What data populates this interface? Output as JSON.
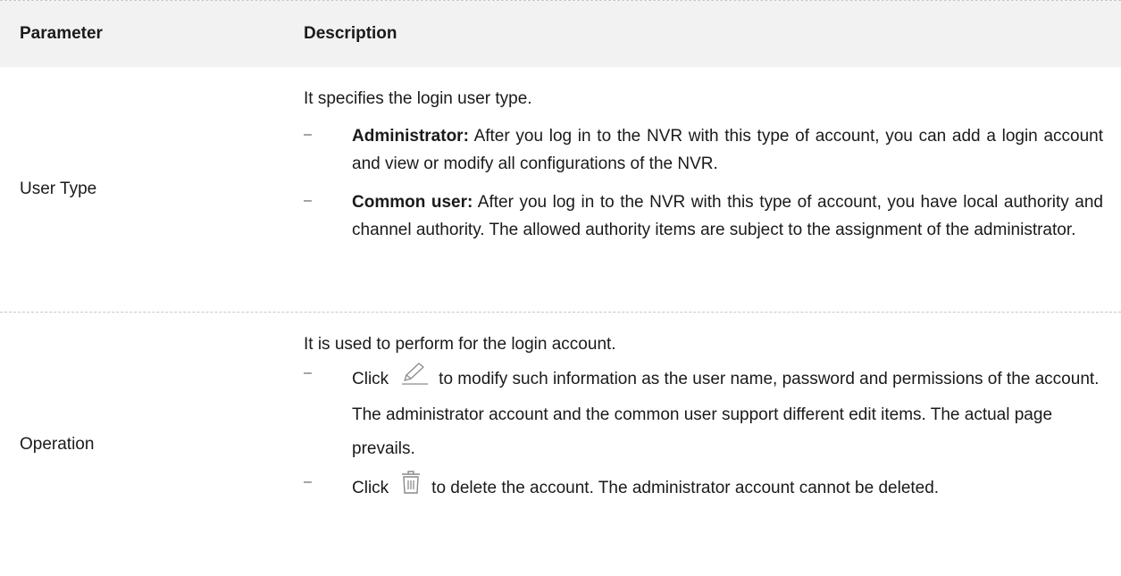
{
  "header": {
    "col1": "Parameter",
    "col2": "Description"
  },
  "rows": [
    {
      "parameter": "User Type",
      "lead": "It specifies the login user type.",
      "bullets": [
        {
          "term": "Administrator:",
          "text": " After you log in to the NVR with this type of account, you can add a login account and view or modify all configurations of the NVR."
        },
        {
          "term": "Common user:",
          "text": " After you log in to the NVR with this type of account, you have local authority and channel authority. The allowed authority items are subject to the assignment of the administrator."
        }
      ]
    },
    {
      "parameter": "Operation",
      "lead": "It is used to perform for the login account.",
      "bullets": [
        {
          "prefix": "Click",
          "icon": "edit-pencil-icon",
          "text": "to modify such information as the user name, password and permissions of the account. The administrator account and the common user support different edit items. The actual page prevails."
        },
        {
          "prefix": "Click",
          "icon": "trash-icon",
          "text": "to delete the account. The administrator account cannot be deleted."
        }
      ]
    }
  ],
  "dash": "–"
}
